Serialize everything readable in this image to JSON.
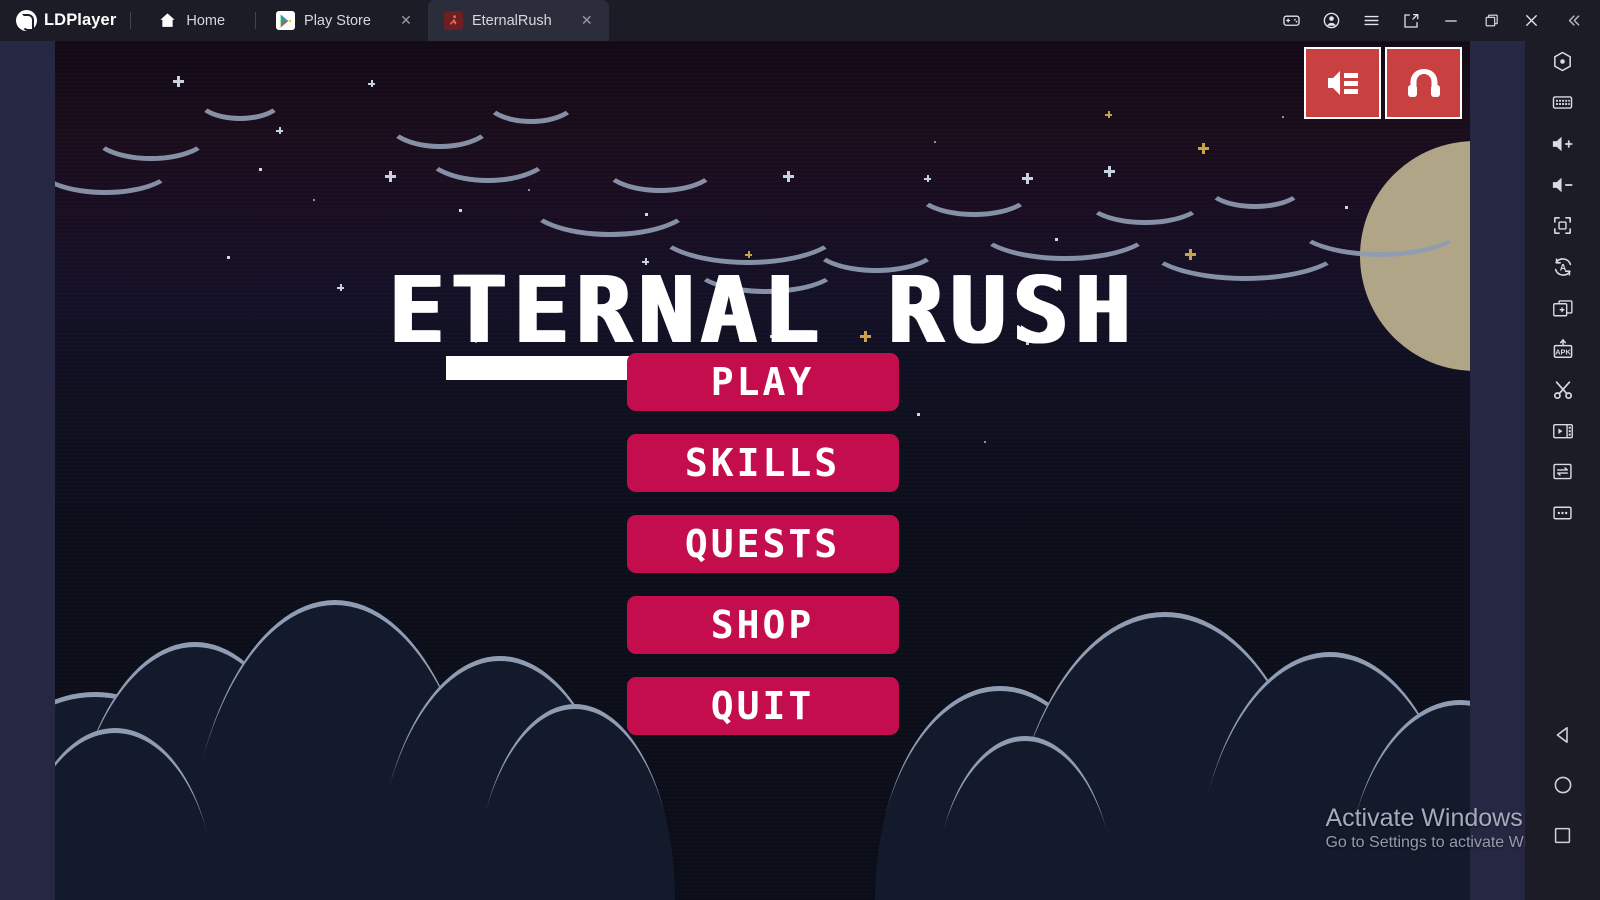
{
  "titlebar": {
    "brand": "LDPlayer",
    "brand_icon": "ldplayer-logo-icon",
    "tabs": [
      {
        "label": "Home",
        "icon": "home-icon",
        "closable": false,
        "active": false
      },
      {
        "label": "Play Store",
        "icon": "play-store-icon",
        "closable": true,
        "active": false
      },
      {
        "label": "EternalRush",
        "icon": "eternalrush-app-icon",
        "closable": true,
        "active": true
      }
    ],
    "close_glyph": "✕",
    "controls": [
      {
        "name": "gamepad-icon",
        "title": "Keyboard mapping"
      },
      {
        "name": "account-icon",
        "title": "Account"
      },
      {
        "name": "menu-icon",
        "title": "Menu"
      },
      {
        "name": "new-window-icon",
        "title": "New window"
      },
      {
        "name": "minimize-icon",
        "title": "Minimize"
      },
      {
        "name": "maximize-icon",
        "title": "Maximize"
      },
      {
        "name": "close-icon",
        "title": "Close"
      },
      {
        "name": "collapse-icon",
        "title": "Collapse sidebar"
      }
    ]
  },
  "sidebar": {
    "items": [
      {
        "name": "settings-icon",
        "title": "Settings"
      },
      {
        "name": "keyboard-icon",
        "title": "Keyboard mapping"
      },
      {
        "name": "volume-up-icon",
        "title": "Volume up"
      },
      {
        "name": "volume-down-icon",
        "title": "Volume down"
      },
      {
        "name": "fullscreen-icon",
        "title": "Fullscreen"
      },
      {
        "name": "auto-rotate-icon",
        "title": "Rotate screen"
      },
      {
        "name": "multi-instance-icon",
        "title": "Multi-instance"
      },
      {
        "name": "apk-install-icon",
        "title": "Install APK"
      },
      {
        "name": "scissors-icon",
        "title": "Screenshot / cut"
      },
      {
        "name": "screen-record-icon",
        "title": "Record screen"
      },
      {
        "name": "file-transfer-icon",
        "title": "File transfer"
      },
      {
        "name": "more-icon",
        "title": "More"
      }
    ],
    "nav": [
      {
        "name": "android-back-icon",
        "title": "Back"
      },
      {
        "name": "android-home-icon",
        "title": "Home"
      },
      {
        "name": "android-recents-icon",
        "title": "Recents"
      }
    ]
  },
  "game": {
    "title": "ETERNAL RUSH",
    "hud": [
      {
        "name": "sound-icon",
        "title": "Sound"
      },
      {
        "name": "headphones-icon",
        "title": "Music"
      }
    ],
    "menu": [
      {
        "label": "PLAY"
      },
      {
        "label": "SKILLS"
      },
      {
        "label": "QUESTS"
      },
      {
        "label": "SHOP"
      },
      {
        "label": "QUIT"
      }
    ],
    "colors": {
      "button": "#c40d4d",
      "hud_button": "#c8403f",
      "title_text": "#ffffff",
      "sky_top": "#190e22",
      "sky_bottom": "#0b0e18",
      "moon": "#b0a687",
      "cloud_outline": "#8f9cb2",
      "cloud_body": "#121a2b"
    }
  },
  "watermark": {
    "title": "Activate Windows",
    "subtitle": "Go to Settings to activate Windows."
  }
}
